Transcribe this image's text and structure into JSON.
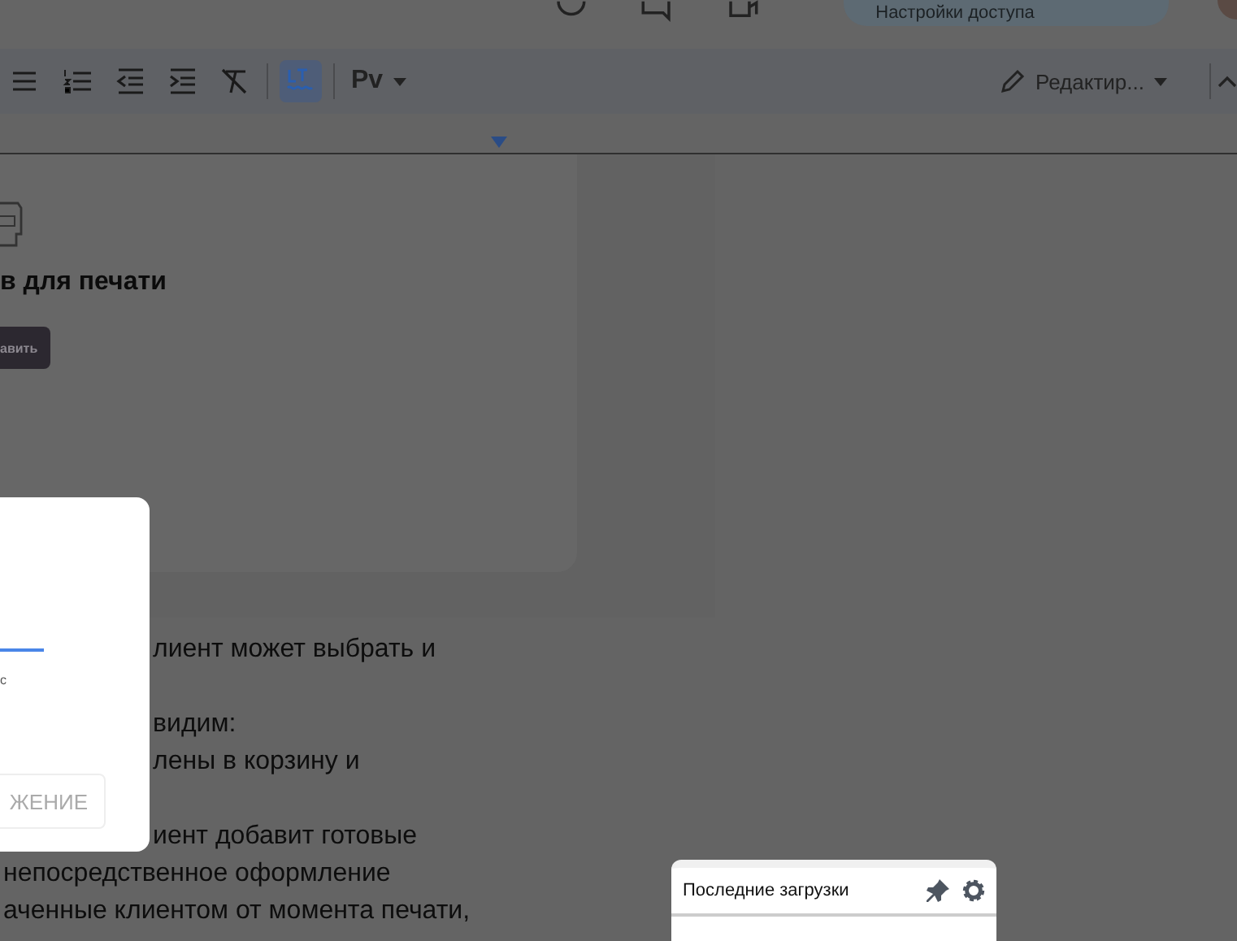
{
  "top_bar": {
    "share_button": "Настройки доступа"
  },
  "toolbar": {
    "style_label": "Рv",
    "mode_label": "Редактир...",
    "tools": [
      {
        "kind": "bullets",
        "selected": false
      },
      {
        "kind": "numbers",
        "selected": false
      },
      {
        "kind": "outdent",
        "selected": false
      },
      {
        "kind": "indent",
        "selected": false
      },
      {
        "kind": "clear",
        "selected": false
      },
      {
        "kind": "languagetool",
        "selected": true
      }
    ]
  },
  "document": {
    "banner": {
      "title": "в для печати",
      "button": "авить"
    },
    "paragraphs": [
      [
        "лиент может выбрать и"
      ],
      [
        "видим:",
        "лены в корзину и"
      ],
      [
        "иент добавит готовые",
        "непосредственное оформление",
        "аченные клиентом от момента печати,"
      ]
    ]
  },
  "dialog": {
    "note": "с",
    "button": "ЖЕНИЕ"
  },
  "downloads": {
    "title": "Последние загрузки"
  }
}
